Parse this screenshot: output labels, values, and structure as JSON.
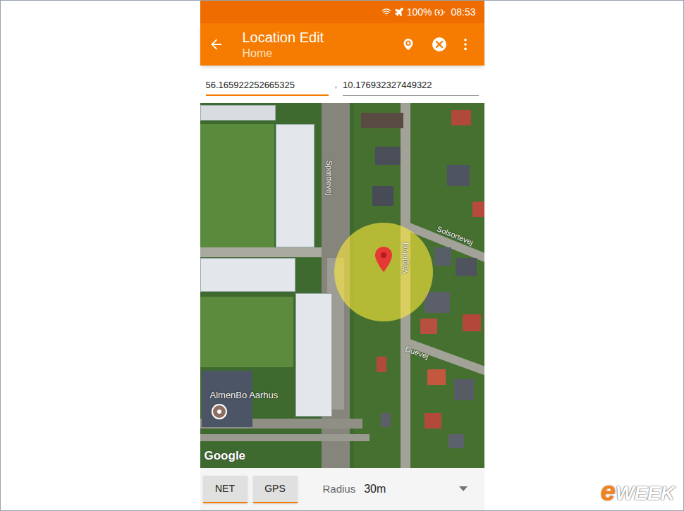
{
  "status_bar": {
    "battery": "100%",
    "time": "08:53"
  },
  "app_bar": {
    "title": "Location Edit",
    "subtitle": "Home"
  },
  "coordinates": {
    "latitude": "56.165922252665325",
    "latitude_focused": true,
    "separator": ",",
    "longitude": "10.176932327449322",
    "longitude_focused": false
  },
  "map": {
    "streets": [
      {
        "text": "Spættevej"
      },
      {
        "text": "Solsortevej"
      },
      {
        "text": "Vagtelvej"
      },
      {
        "text": "Duevej"
      }
    ],
    "place": "AlmenBo Aarhus",
    "attribution": "Google"
  },
  "buttons": [
    {
      "label": "NET"
    },
    {
      "label": "GPS"
    }
  ],
  "radius": {
    "label": "Radius",
    "value": "30m"
  },
  "watermark": {
    "prefix": "e",
    "name": "WEEK"
  }
}
